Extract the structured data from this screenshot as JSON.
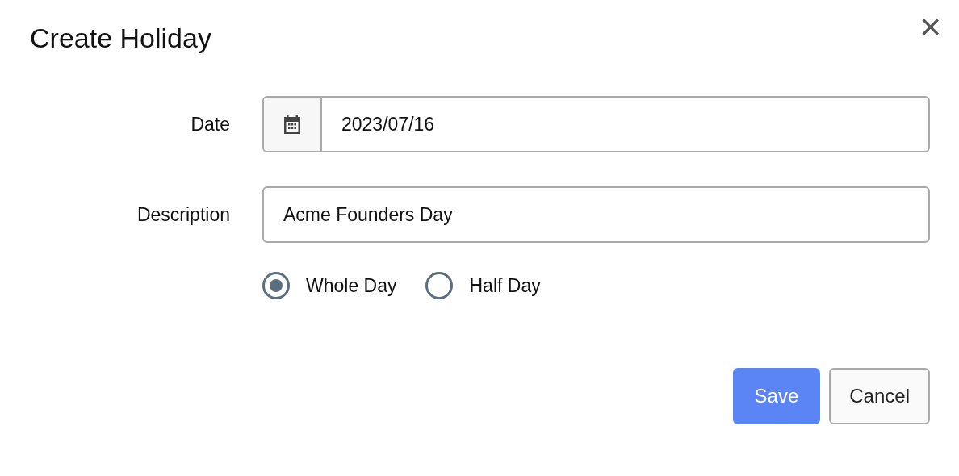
{
  "dialog": {
    "title": "Create Holiday",
    "close": "×"
  },
  "fields": [
    {
      "kind": "date",
      "label": "Date",
      "value": "2023/07/16"
    },
    {
      "kind": "text",
      "label": "Description",
      "value": "Acme Founders Day"
    }
  ],
  "day_options": [
    {
      "label": "Whole Day",
      "selected": true
    },
    {
      "label": "Half Day",
      "selected": false
    }
  ],
  "buttons": [
    {
      "label": "Save",
      "kind": "primary"
    },
    {
      "label": "Cancel",
      "kind": "secondary"
    }
  ]
}
